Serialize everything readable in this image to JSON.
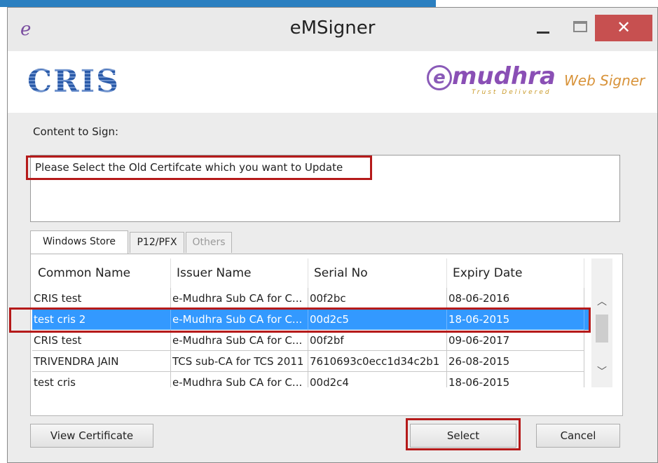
{
  "window": {
    "title": "eMSigner",
    "close_glyph": "✕",
    "icon": "emudhra-e-icon"
  },
  "branding": {
    "left_logo": "CRIS",
    "right_logo_mark": "e",
    "right_logo_brand": "mudhra",
    "right_logo_tagline": "Trust Delivered",
    "product": "Web Signer"
  },
  "content": {
    "label": "Content to Sign:",
    "text": "Please Select the Old Certifcate which you want to Update"
  },
  "tabs": [
    {
      "label": "Windows Store",
      "state": "active"
    },
    {
      "label": "P12/PFX",
      "state": "normal"
    },
    {
      "label": "Others",
      "state": "disabled"
    }
  ],
  "grid": {
    "columns": [
      "Common Name",
      "Issuer Name",
      "Serial No",
      "Expiry Date"
    ],
    "rows": [
      [
        "CRIS test",
        "e-Mudhra Sub CA for C...",
        "00f2bc",
        "08-06-2016"
      ],
      [
        "test cris 2",
        "e-Mudhra Sub CA for C...",
        "00d2c5",
        "18-06-2015"
      ],
      [
        "CRIS test",
        "e-Mudhra Sub CA for C...",
        "00f2bf",
        "09-06-2017"
      ],
      [
        "TRIVENDRA JAIN",
        "TCS sub-CA for TCS 2011",
        "7610693c0ecc1d34c2b1",
        "26-08-2015"
      ],
      [
        "test cris",
        "e-Mudhra Sub CA for C...",
        "00d2c4",
        "18-06-2015"
      ]
    ],
    "selected_row": 1,
    "scroll_up": "︿",
    "scroll_down": "﹀"
  },
  "buttons": {
    "view_certificate": "View Certificate",
    "select": "Select",
    "cancel": "Cancel"
  },
  "colors": {
    "selection": "#3399ff",
    "highlight_box": "#b51a1a",
    "close_button": "#c75050"
  }
}
